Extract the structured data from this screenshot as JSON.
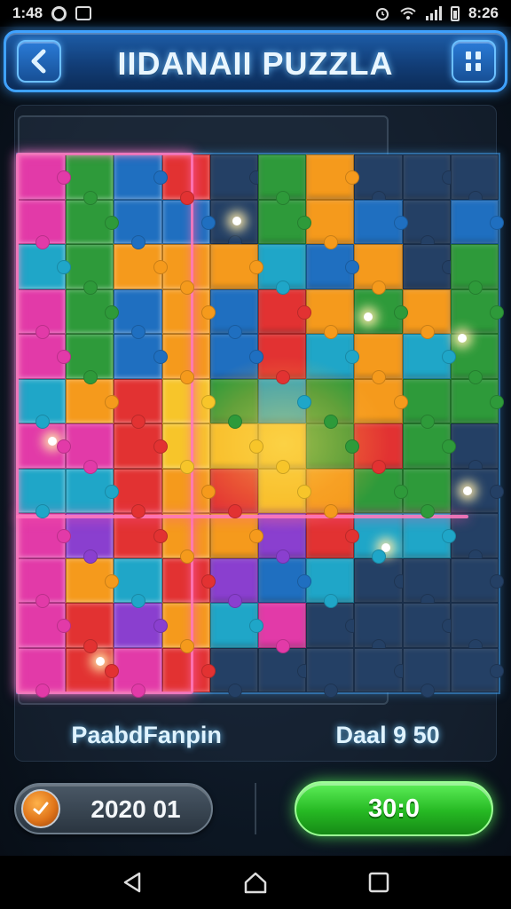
{
  "status_bar": {
    "time": "1:48",
    "battery_text": "8:26",
    "icons": [
      "circle-icon",
      "square-icon",
      "alarm-icon",
      "wifi-icon",
      "signal-icon",
      "battery-icon"
    ]
  },
  "header": {
    "title": "IIDANAII PUZZLA",
    "back_icon": "chevron-left-icon",
    "menu_icon": "grid-icon"
  },
  "board": {
    "columns": 10,
    "rows": 12,
    "colors": {
      "M": "#e23aa8",
      "G": "#2e9a3a",
      "B": "#1f6fc0",
      "R": "#e23232",
      "O": "#f59a1c",
      "Y": "#f7c52a",
      "C": "#1fa6c8",
      "P": "#8a3fcf",
      "L": "#2a5a9a",
      "T": "#2f7f88"
    },
    "layout": [
      "MGBRLGOLLL",
      "MGBBLGOBLB",
      "CGOOOCBOLG",
      "MGBOBROGOG",
      "MGBOBRCOCG",
      "CORYGCGOGG",
      "MMRYYYGRGL",
      "CCRORYOGGL",
      "MPROOPRCCL",
      "MOCRPBCLLL",
      "MRPOCMLLLL",
      "MRMRLLLLLL"
    ]
  },
  "info": {
    "left_label": "PaabdFanpin",
    "right_label": "Daal 9 50"
  },
  "controls": {
    "timer_value": "2020 01",
    "timer_icon": "clock-icon",
    "score_value": "30:0"
  },
  "nav": {
    "back_icon": "triangle-back-icon",
    "home_icon": "home-icon",
    "recents_icon": "square-recents-icon"
  }
}
